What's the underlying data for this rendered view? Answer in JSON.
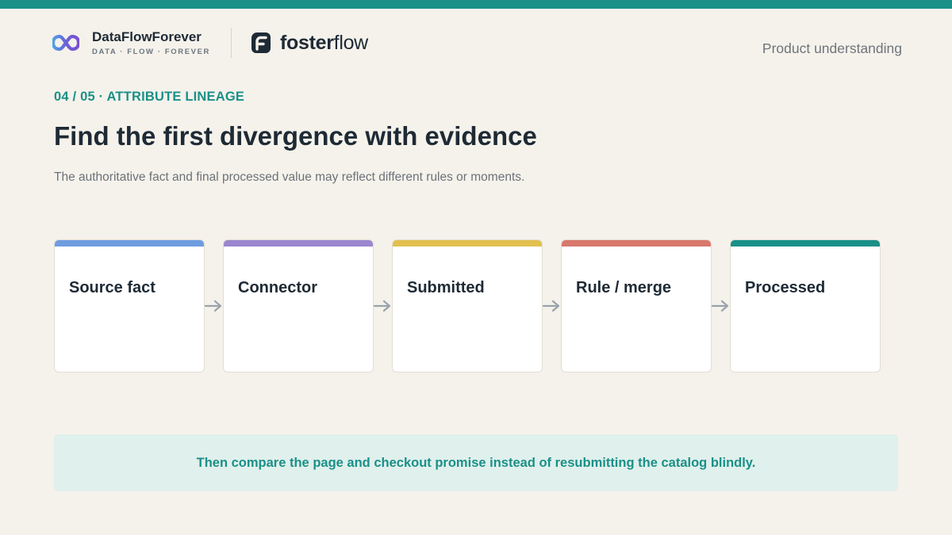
{
  "brand": {
    "primary_name": "DataFlowForever",
    "primary_tagline": "DATA · FLOW · FOREVER",
    "partner_name_bold": "foster",
    "partner_name_light": "flow",
    "accent_color": "#1a9088"
  },
  "header": {
    "section": "Product understanding"
  },
  "slide": {
    "eyebrow": "04 / 05 · ATTRIBUTE LINEAGE",
    "title": "Find the first divergence with evidence",
    "subtitle": "The authoritative fact and final processed value may reflect different rules or moments."
  },
  "pipeline": {
    "stages": [
      {
        "label": "Source fact",
        "color": "#6e9de0"
      },
      {
        "label": "Connector",
        "color": "#9b86cf"
      },
      {
        "label": "Submitted",
        "color": "#e2c04f"
      },
      {
        "label": "Rule / merge",
        "color": "#d9786c"
      },
      {
        "label": "Processed",
        "color": "#1a9088"
      }
    ],
    "connector_icon": "arrow-right-icon"
  },
  "callout": {
    "text": "Then compare the page and checkout promise instead of resubmitting the catalog blindly."
  }
}
